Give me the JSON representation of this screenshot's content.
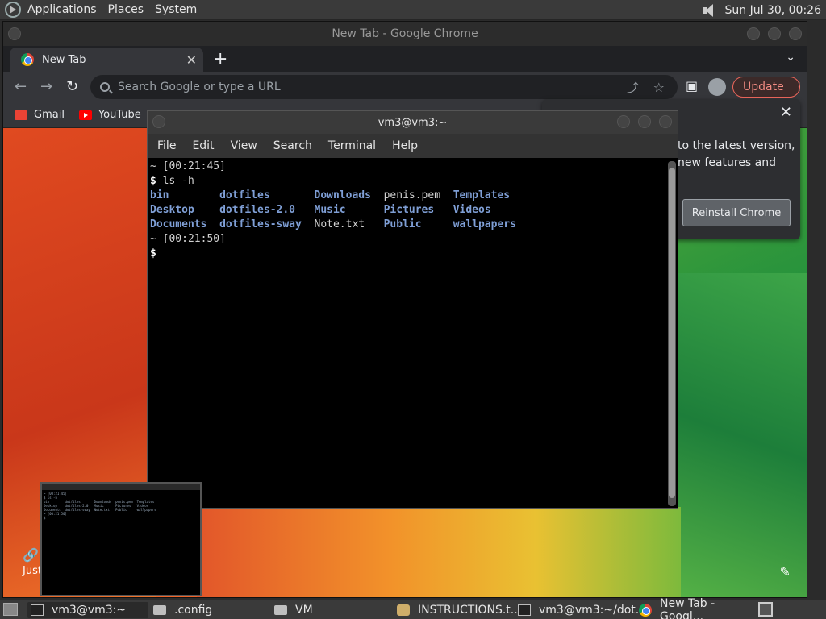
{
  "top_panel": {
    "menus": [
      "Applications",
      "Places",
      "System"
    ],
    "clock": "Sun Jul 30, 00:26"
  },
  "chrome": {
    "window_title": "New Tab - Google Chrome",
    "tab_label": "New Tab",
    "omnibox_placeholder": "Search Google or type a URL",
    "update_label": "Update",
    "bookmarks": [
      "Gmail",
      "YouTube"
    ],
    "popup_text": "to the latest version, new features and",
    "reinstall_label": "Reinstall Chrome",
    "bottom_link": "Just"
  },
  "terminal": {
    "title": "vm3@vm3:~",
    "menu": [
      "File",
      "Edit",
      "View",
      "Search",
      "Terminal",
      "Help"
    ],
    "lines": [
      {
        "parts": [
          {
            "t": "~ [00:21:45]",
            "c": "file"
          }
        ]
      },
      {
        "parts": [
          {
            "t": "$ ",
            "c": "prompt"
          },
          {
            "t": "ls -h",
            "c": "file"
          }
        ]
      },
      {
        "parts": [
          {
            "t": "bin        ",
            "c": "dir"
          },
          {
            "t": "dotfiles       ",
            "c": "dir"
          },
          {
            "t": "Downloads  ",
            "c": "dir"
          },
          {
            "t": "penis.pem  ",
            "c": "file"
          },
          {
            "t": "Templates",
            "c": "dir"
          }
        ]
      },
      {
        "parts": [
          {
            "t": "Desktop    ",
            "c": "dir"
          },
          {
            "t": "dotfiles-2.0   ",
            "c": "dir"
          },
          {
            "t": "Music      ",
            "c": "dir"
          },
          {
            "t": "Pictures   ",
            "c": "dir"
          },
          {
            "t": "Videos",
            "c": "dir"
          }
        ]
      },
      {
        "parts": [
          {
            "t": "Documents  ",
            "c": "dir"
          },
          {
            "t": "dotfiles-sway  ",
            "c": "dir"
          },
          {
            "t": "Note.txt   ",
            "c": "file"
          },
          {
            "t": "Public     ",
            "c": "dir"
          },
          {
            "t": "wallpapers",
            "c": "dir"
          }
        ]
      },
      {
        "parts": [
          {
            "t": "~ [00:21:50]",
            "c": "file"
          }
        ]
      },
      {
        "parts": [
          {
            "t": "$ ",
            "c": "prompt"
          }
        ]
      }
    ]
  },
  "taskbar": {
    "items": [
      "vm3@vm3:~",
      ".config",
      "VM",
      "INSTRUCTIONS.t...",
      "vm3@vm3:~/dot...",
      "New Tab - Googl..."
    ]
  }
}
